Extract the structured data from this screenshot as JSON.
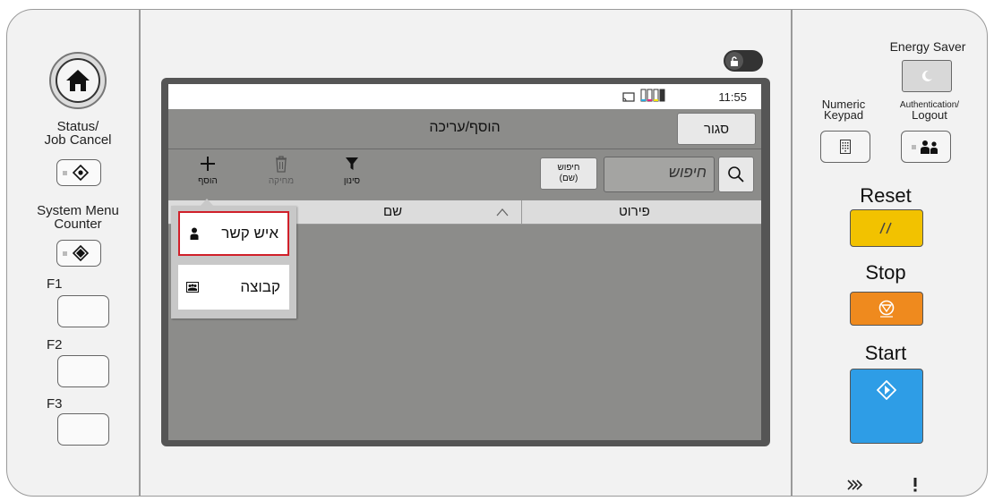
{
  "left_panel": {
    "status_label_1": "Status/",
    "status_label_2": "Job Cancel",
    "system_label_1": "System Menu",
    "system_label_2": "Counter",
    "f1": "F1",
    "f2": "F2",
    "f3": "F3"
  },
  "screen": {
    "clock": "11:55",
    "title": "הוסף/עריכה",
    "close_label": "סגור",
    "toolbar": {
      "add_label": "הוסף",
      "delete_label": "מחיקה",
      "filter_label": "סינון"
    },
    "search_scope_1": "חיפוש",
    "search_scope_2": "(שם)",
    "search_placeholder": "חיפוש",
    "table": {
      "col_name": "שם",
      "col_details": "פירוט"
    },
    "add_menu": {
      "items": [
        {
          "label": "איש קשר",
          "icon": "person-icon",
          "selected": true
        },
        {
          "label": "קבוצה",
          "icon": "group-icon",
          "selected": false
        }
      ]
    }
  },
  "right_panel": {
    "energy_saver": "Energy Saver",
    "numeric_keypad_1": "Numeric",
    "numeric_keypad_2": "Keypad",
    "auth_1": "Authentication/",
    "auth_2": "Logout",
    "reset": "Reset",
    "stop": "Stop",
    "start": "Start",
    "colors": {
      "reset": "#f2c200",
      "stop": "#ef8a1e",
      "start": "#2e9de6"
    }
  }
}
